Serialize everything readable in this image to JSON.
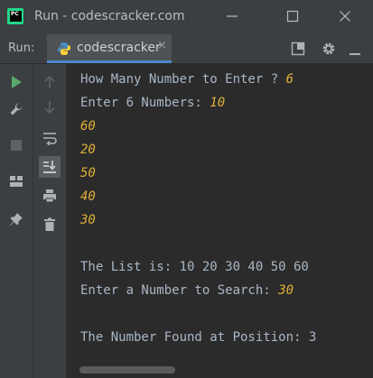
{
  "window": {
    "title": "Run - codescracker.com",
    "logo_text": "PC",
    "controls": [
      "minimize-icon",
      "maximize-icon",
      "close-icon"
    ]
  },
  "run_toolbar": {
    "label": "Run:",
    "tab": {
      "label": "codescracker",
      "icon": "python-icon",
      "close": "×"
    },
    "actions": [
      "layout-icon",
      "gear-icon",
      "minimize-panel-icon"
    ]
  },
  "sidebar": {
    "tools": [
      "run-icon",
      "wrench-icon",
      "stop-icon",
      "layout-icon",
      "pin-icon"
    ],
    "secondary_tools": [
      "scroll-up-icon",
      "scroll-down-icon",
      "soft-wrap-icon",
      "scroll-to-end-icon",
      "print-icon",
      "trash-icon"
    ]
  },
  "console": {
    "lines": [
      {
        "prompt": "How Many Number to Enter ? ",
        "input": "6"
      },
      {
        "prompt": "Enter 6 Numbers: ",
        "input": "10"
      },
      {
        "prompt": "",
        "input": "60"
      },
      {
        "prompt": "",
        "input": "20"
      },
      {
        "prompt": "",
        "input": "50"
      },
      {
        "prompt": "",
        "input": "40"
      },
      {
        "prompt": "",
        "input": "30"
      },
      {
        "prompt": "",
        "input": ""
      },
      {
        "prompt": "The List is: 10 20 30 40 50 60",
        "input": ""
      },
      {
        "prompt": "Enter a Number to Search: ",
        "input": "30"
      },
      {
        "prompt": "",
        "input": ""
      },
      {
        "prompt": "The Number Found at Position: 3",
        "input": ""
      }
    ]
  },
  "colors": {
    "console_bg": "#2b2b2b",
    "output_text": "#a9b7c6",
    "user_input": "#e0b13a",
    "run_green": "#59a869",
    "tab_underline": "#4a88c7"
  }
}
